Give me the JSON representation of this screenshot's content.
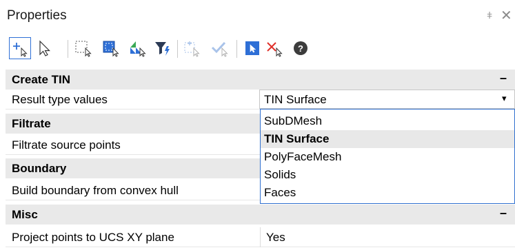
{
  "panel": {
    "title": "Properties",
    "pin_glyph": "ǂ",
    "close_glyph": "✕"
  },
  "toolbar": {
    "tools": [
      {
        "icon": "add-points-icon",
        "selected": true
      },
      {
        "icon": "select-arrow-icon"
      },
      {
        "icon": "select-window-icon"
      },
      {
        "icon": "select-points-blue-icon"
      },
      {
        "icon": "select-green-blue-icon"
      },
      {
        "icon": "filter-icon"
      },
      {
        "icon": "select-disabled-icon"
      },
      {
        "icon": "check-disabled-icon"
      },
      {
        "icon": "pick-blue-icon"
      },
      {
        "icon": "deselect-red-icon"
      },
      {
        "icon": "help-icon"
      }
    ]
  },
  "sections": {
    "create_tin": {
      "title": "Create TIN",
      "collapse_glyph": "–",
      "result_type_label": "Result type values",
      "result_type_value": "TIN Surface"
    },
    "filtrate": {
      "title": "Filtrate",
      "source_points_label": "Filtrate source points"
    },
    "boundary": {
      "title": "Boundary",
      "convex_hull_label": "Build boundary from convex hull"
    },
    "misc": {
      "title": "Misc",
      "collapse_glyph": "–",
      "project_label": "Project points to UCS XY plane",
      "project_value": "Yes"
    }
  },
  "dropdown": {
    "arrow_glyph": "▾",
    "options": [
      "SubDMesh",
      "TIN Surface",
      "PolyFaceMesh",
      "Solids",
      "Faces"
    ],
    "selected": "TIN Surface"
  },
  "colors": {
    "accent": "#2e6fd6",
    "category_bg": "#e9e9e9",
    "red": "#e0302a",
    "green": "#3aa856"
  }
}
